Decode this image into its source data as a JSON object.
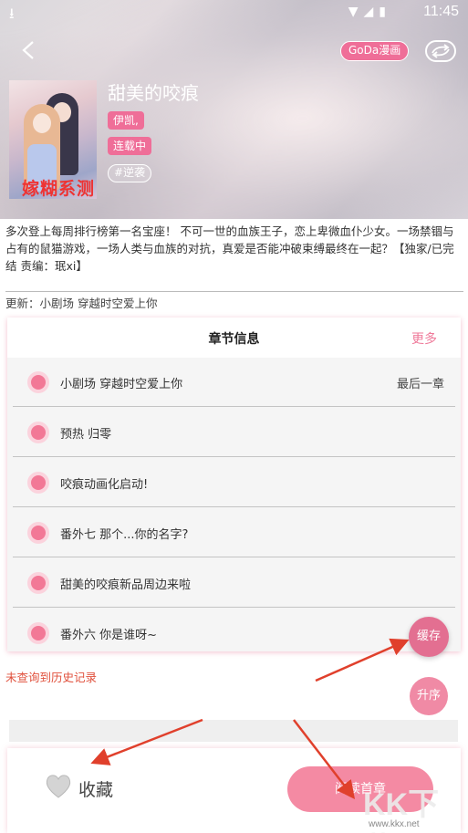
{
  "status_bar": {
    "time": "11:45",
    "download_icon": "download-icon",
    "wifi_icon": "wifi-icon",
    "signal_icon": "no-signal-icon",
    "battery_icon": "battery-icon"
  },
  "header": {
    "back_icon": "chevron-left-icon",
    "brand_label": "GoDa漫画",
    "share_icon": "share-icon"
  },
  "comic": {
    "title": "甜美的咬痕",
    "author_tag": "伊凯,",
    "status_tag": "连载中",
    "genre_tag": "#逆袭",
    "cover_watermark": "嫁糊系测",
    "description": "多次登上每周排行榜第一名宝座！ 不可一世的血族王子，恋上卑微血仆少女。一场禁锢与占有的鼠猫游戏，一场人类与血族的对抗，真爱是否能冲破束缚最终在一起？【独家/已完结 责编：珉xi】",
    "update": "更新：小剧场 穿越时空爱上你"
  },
  "chapter_card": {
    "title": "章节信息",
    "more": "更多",
    "chapters": [
      {
        "label": "小剧场 穿越时空爱上你",
        "tail": "最后一章"
      },
      {
        "label": "预热 归零",
        "tail": ""
      },
      {
        "label": "咬痕动画化启动!",
        "tail": ""
      },
      {
        "label": "番外七 那个...你的名字?",
        "tail": ""
      },
      {
        "label": "甜美的咬痕新品周边来啦",
        "tail": ""
      },
      {
        "label": "番外六 你是谁呀~",
        "tail": ""
      }
    ]
  },
  "actions": {
    "cache": "缓存",
    "sort": "升序",
    "history": "未查询到历史记录",
    "favorite": "收藏",
    "favorite_icon": "heart-icon",
    "read_first": "阅读首章"
  },
  "site_watermark": {
    "big": "KK下载",
    "small": "www.kkx.net"
  },
  "colors": {
    "accent": "#ef6e98",
    "arrow": "#e0402c",
    "history_text": "#e0503c"
  }
}
